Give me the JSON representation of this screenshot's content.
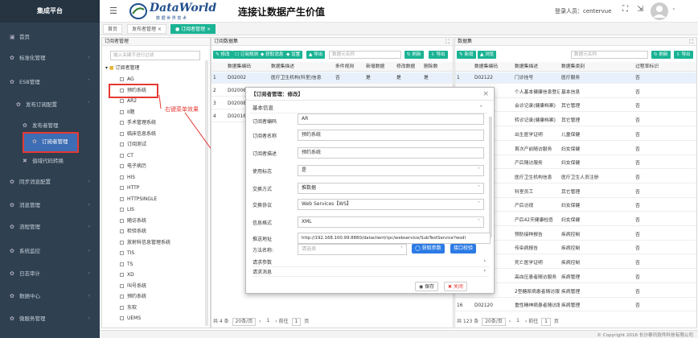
{
  "sidebar": {
    "title": "集成平台",
    "items": [
      {
        "icon": "▣",
        "label": "首页"
      },
      {
        "icon": "✿",
        "label": "标准化管理",
        "chev": "›"
      },
      {
        "icon": "✿",
        "label": "ESB管理",
        "chev": "˅"
      },
      {
        "icon": "✿",
        "label": "发布订阅配置",
        "chev": "˅"
      },
      {
        "icon": "✿",
        "label": "发布者管理"
      },
      {
        "icon": "✿",
        "label": "订阅者管理"
      },
      {
        "icon": "✖",
        "label": "值域代码转换"
      },
      {
        "icon": "✿",
        "label": "同步消息配置",
        "chev": "›"
      },
      {
        "icon": "✿",
        "label": "消息管理",
        "chev": "›"
      },
      {
        "icon": "✿",
        "label": "流程管理",
        "chev": "›"
      },
      {
        "icon": "✿",
        "label": "系统监控",
        "chev": "›"
      },
      {
        "icon": "✿",
        "label": "日志审计",
        "chev": "›"
      },
      {
        "icon": "✿",
        "label": "数据中心",
        "chev": "›"
      },
      {
        "icon": "✿",
        "label": "微服务管理",
        "chev": "›"
      }
    ]
  },
  "header": {
    "menu_icon": "☰",
    "logo_text": "DataWorld",
    "logo_sub": "数 据 世 界 技 术",
    "slogan": "连接让数据产生价值",
    "login": "登录人员：centervue",
    "fullscreen": "⛶",
    "shrink": "⇲"
  },
  "tabs": [
    {
      "label": "首页"
    },
    {
      "label": "发布者管理 ×"
    },
    {
      "label": "● 订阅者管理 ×"
    }
  ],
  "tree_panel": {
    "title": "订阅者管理",
    "search_placeholder": "输入关键字进行过滤",
    "root": "订阅者管理",
    "items": [
      "AG",
      "预约系统",
      "AR2",
      "II题",
      "手术管理系统",
      "临床信息系统",
      "订阅测试",
      "CT",
      "电子病历",
      "HIS",
      "HTTP",
      "HTTPSINGLE",
      "LIS",
      "随访系统",
      "检验系统",
      "放射科信息管理系统",
      "TIS",
      "TS",
      "XD",
      "叫号系统",
      "预约系统",
      "东软",
      "UEMS"
    ]
  },
  "annotation": {
    "text": "右键菜单效果"
  },
  "sub_panel": {
    "title": "订阅数据集",
    "toolbar": [
      "✎ 修改",
      "☐ 订阅规则",
      "◆ 获取消息",
      "◆ 设置",
      "▲ 导出"
    ],
    "search_placeholder": "数据元名称",
    "refresh": "↻ 刷新",
    "export": "⇩ 导出",
    "columns": [
      "",
      "数据集编码",
      "数据集描述",
      "条件规则",
      "新增数据",
      "修改数据",
      "删除数"
    ],
    "rows": [
      [
        "1",
        "D02002",
        "医疗卫生机构(科室)信息",
        "否",
        "是",
        "是",
        "是"
      ],
      [
        "2",
        "D02006",
        "",
        "",
        "",
        "",
        ""
      ],
      [
        "3",
        "D02008",
        "",
        "",
        "",
        "",
        ""
      ],
      [
        "4",
        "D02016",
        "",
        "",
        "",
        "",
        ""
      ]
    ],
    "total": "共 4 条",
    "page_size": "20条/页",
    "prev": "前往",
    "page": "1",
    "page_unit": "页"
  },
  "ds_panel": {
    "title": "数据集",
    "toolbar": [
      "✎ 新增",
      "▲ 浏览"
    ],
    "search_placeholder": "数据元名称",
    "refresh": "↻ 刷新",
    "export": "⇩ 导出",
    "columns": [
      "",
      "数据集编码",
      "数据集描述",
      "数据集类别",
      "过程率标识"
    ],
    "rows": [
      [
        "1",
        "D02122",
        "门诊挂号",
        "医疗服务",
        "否"
      ],
      [
        "",
        "",
        "个人基本健康信息登记",
        "基本信息",
        "否"
      ],
      [
        "",
        "",
        "会诊记录(健康档案)",
        "其它管理",
        "否"
      ],
      [
        "",
        "",
        "转诊记录(健康档案)",
        "其它管理",
        "否"
      ],
      [
        "",
        "",
        "出生医学证明",
        "儿童保健",
        "否"
      ],
      [
        "",
        "",
        "首次产前随访服务",
        "妇女保健",
        "否"
      ],
      [
        "",
        "",
        "产后随访服务",
        "妇女保健",
        "否"
      ],
      [
        "",
        "",
        "医疗卫生机构信息",
        "医疗卫生人员注册",
        "否"
      ],
      [
        "",
        "",
        "科室员工",
        "其它管理",
        "否"
      ],
      [
        "",
        "",
        "产后访视",
        "妇女保健",
        "否"
      ],
      [
        "",
        "",
        "产后42天健康检查",
        "妇女保健",
        "否"
      ],
      [
        "",
        "",
        "预防接种报告",
        "疾病控制",
        "否"
      ],
      [
        "",
        "",
        "传染病报告",
        "疾病控制",
        "否"
      ],
      [
        "",
        "",
        "死亡医学证明",
        "疾病控制",
        "否"
      ],
      [
        "",
        "",
        "高血压患者随访服务",
        "疾病管理",
        "否"
      ],
      [
        "",
        "",
        "2型糖尿病患者随访服务",
        "疾病管理",
        "否"
      ],
      [
        "16",
        "D02120",
        "重性精神病患者随访服务",
        "疾病管理",
        "否"
      ]
    ],
    "total": "共 123 条",
    "page_size": "20条/页",
    "prev": "前往",
    "page": "1",
    "page_unit": "页"
  },
  "modal": {
    "title": "【订阅者管理：修改】",
    "close": "×",
    "section": "基本信息",
    "fields": [
      {
        "label": "订阅者编码",
        "value": "AR"
      },
      {
        "label": "订阅者名称",
        "value": "预约系统"
      },
      {
        "label": "订阅者描述",
        "value": "预约系统"
      },
      {
        "label": "使用标志",
        "value": "是",
        "dd": "˅"
      },
      {
        "label": "交换方式",
        "value": "推数据",
        "dd": "˅"
      },
      {
        "label": "交换协议",
        "value": "Web Services【WS】",
        "dd": "˅"
      },
      {
        "label": "信息格式",
        "value": "XML",
        "dd": "˅"
      },
      {
        "label": "推送地址",
        "value": "http://192.168.100.99:8880/dataclient/rpc/webservice/SubTestService?wsdl"
      },
      {
        "label": "方法名称:",
        "value": "请选择",
        "dd": "˅"
      }
    ],
    "get_params": "◯ 获取参数",
    "iface_check": "接口校验",
    "req_params": "请求参数",
    "req_msg": "请求消息",
    "save": "◉ 保存",
    "close_btn": "✖ 关闭"
  },
  "footer": {
    "copyright": "© Copyright 2016 长沙泰讯软件科技有限公司"
  }
}
